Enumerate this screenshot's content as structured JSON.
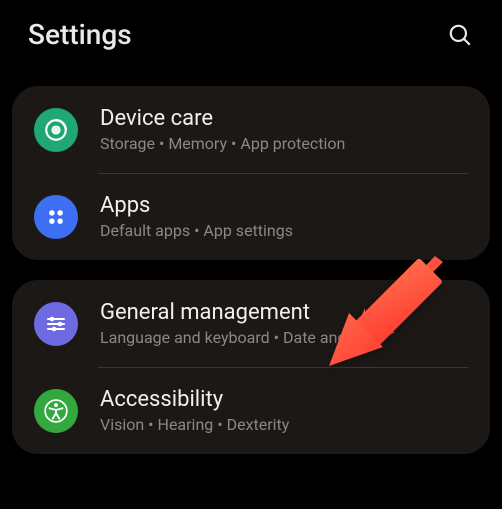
{
  "header": {
    "title": "Settings"
  },
  "groups": [
    {
      "items": [
        {
          "title": "Device care",
          "subtitle": "Storage  •  Memory  •  App protection",
          "icon": "device-care",
          "color": "green"
        },
        {
          "title": "Apps",
          "subtitle": "Default apps  •  App settings",
          "icon": "apps",
          "color": "blue"
        }
      ]
    },
    {
      "items": [
        {
          "title": "General management",
          "subtitle": "Language and keyboard  •  Date and time",
          "icon": "general",
          "color": "purple"
        },
        {
          "title": "Accessibility",
          "subtitle": "Vision  •  Hearing  •  Dexterity",
          "icon": "accessibility",
          "color": "bright-green"
        }
      ]
    }
  ],
  "annotation": {
    "arrow_color": "#ff4b3e"
  }
}
